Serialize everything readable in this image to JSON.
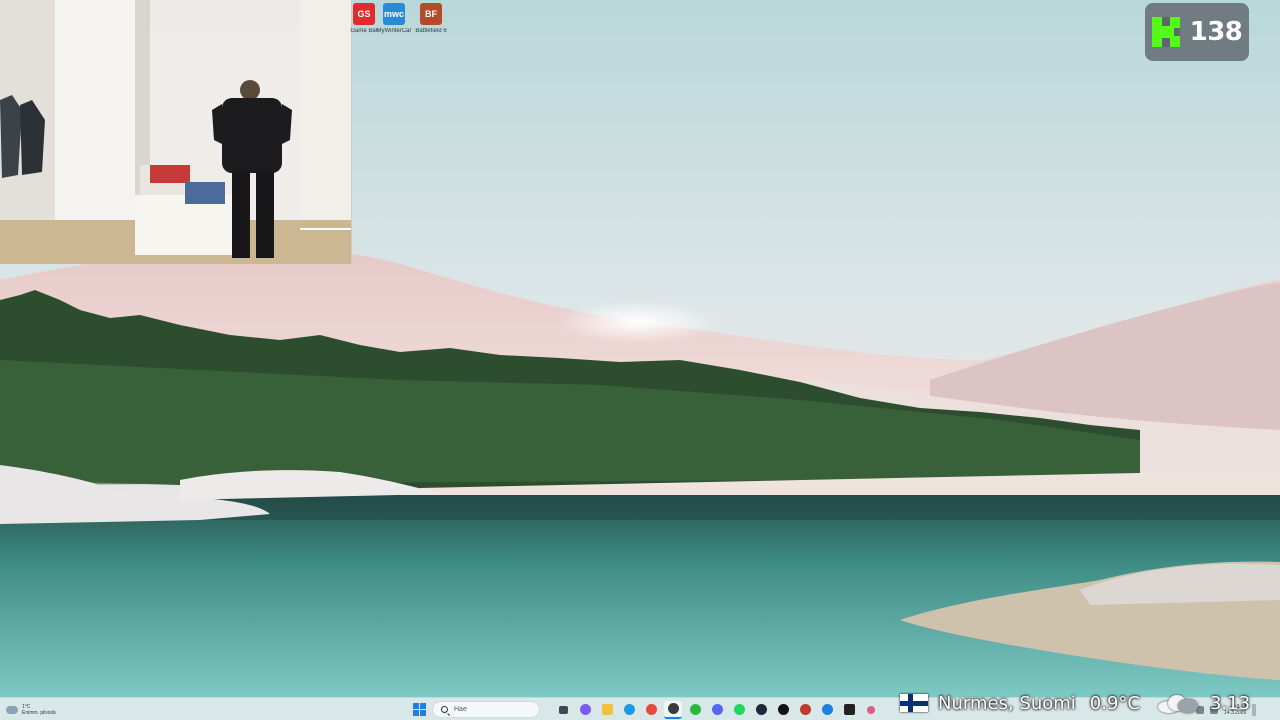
{
  "desktop": {
    "icons": [
      {
        "label": "Game Bar",
        "badge": "GS",
        "color": "#e02b2b"
      },
      {
        "label": "MyWinterCar",
        "badge": "mwc",
        "color": "#2a8ad8"
      },
      {
        "label": "Battlefield 6",
        "badge": "BF",
        "color": "#b34a2a"
      }
    ]
  },
  "webcam": {
    "description_free": true
  },
  "kick": {
    "viewer_count": "138",
    "accent": "#53fc18"
  },
  "weather_overlay": {
    "location": "Nurmes, Suomi",
    "temperature": "0.9°C",
    "time": "3.13",
    "flag": "finland-flag-icon",
    "condition_icon": "cloud-icon"
  },
  "taskbar": {
    "weather_temp": "1°C",
    "weather_text": "Enimm. pilvistä",
    "search_placeholder": "Hae",
    "apps": [
      {
        "name": "task-view",
        "color": "#3b4a55"
      },
      {
        "name": "copilot",
        "color": "#7a5cf0"
      },
      {
        "name": "file-explorer",
        "color": "#f2c23c"
      },
      {
        "name": "edge",
        "color": "#1e9be0"
      },
      {
        "name": "chrome",
        "color": "#e44b3a"
      },
      {
        "name": "obs",
        "color": "#3b3b3b",
        "active": true
      },
      {
        "name": "whatsapp",
        "color": "#2bb741"
      },
      {
        "name": "discord",
        "color": "#5865f2"
      },
      {
        "name": "spotify",
        "color": "#1ed760"
      },
      {
        "name": "steam",
        "color": "#1b2838"
      },
      {
        "name": "kick-app",
        "color": "#111111"
      },
      {
        "name": "mwc-app",
        "color": "#c0392b"
      },
      {
        "name": "settings",
        "color": "#1f7fe0"
      },
      {
        "name": "capcut",
        "color": "#222222"
      },
      {
        "name": "extra-app",
        "color": "#e05a8a"
      }
    ],
    "clock_time": "3.13",
    "clock_date": "14.3.2026"
  }
}
